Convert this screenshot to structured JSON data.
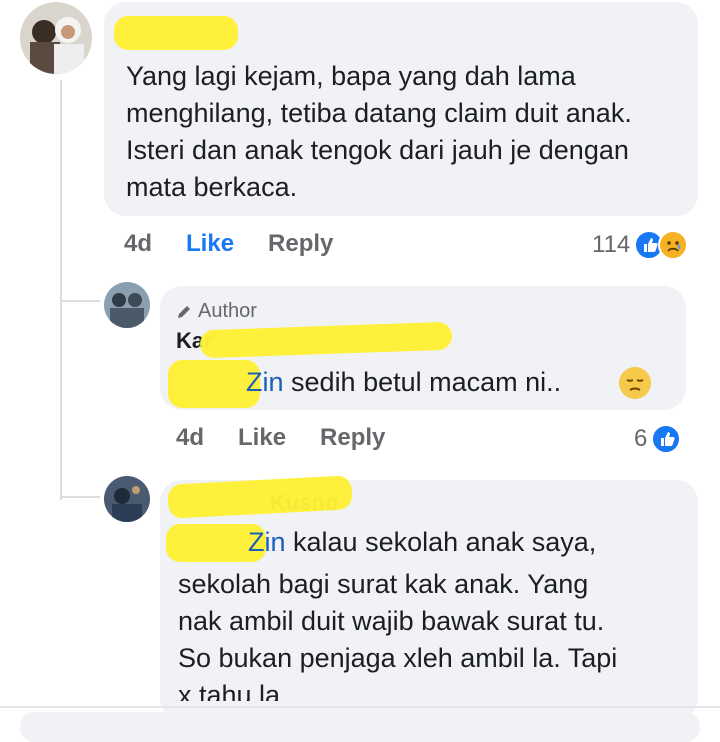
{
  "comments": [
    {
      "text": "Yang lagi kejam, bapa yang dah lama menghilang, tetiba datang claim duit anak. Isteri dan anak tengok dari jauh je dengan mata berkaca.",
      "time": "4d",
      "like_label": "Like",
      "reply_label": "Reply",
      "reaction_count": "114"
    },
    {
      "badge": "Author",
      "name_visible": "Kar",
      "mention_visible": "Zin",
      "text": "sedih betul macam ni..",
      "time": "4d",
      "like_label": "Like",
      "reply_label": "Reply",
      "reaction_count": "6"
    },
    {
      "name_visible": "Kusno",
      "mention_visible": "Zin",
      "text": "kalau sekolah anak saya,",
      "text_lines": [
        "sekolah bagi surat kak anak. Yang",
        "nak ambil duit wajib bawak surat tu.",
        "So bukan penjaga xleh ambil la. Tapi",
        "x tahu la"
      ]
    }
  ],
  "colors": {
    "bubble": "#f0f2f5",
    "like_blue": "#1877f2",
    "highlight": "#ffef36",
    "meta_gray": "#65676b"
  }
}
